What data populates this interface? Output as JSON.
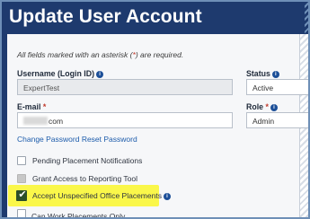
{
  "header": {
    "title": "Update User Account"
  },
  "note": {
    "prefix": "All fields marked with an asterisk (",
    "asterisk": "*",
    "suffix": ") are required."
  },
  "username": {
    "label": "Username (Login ID)",
    "value": "ExpertTest"
  },
  "status": {
    "label": "Status",
    "value": "Active"
  },
  "email": {
    "label": "E-mail",
    "required_mark": "*",
    "value_suffix": "com"
  },
  "role": {
    "label": "Role",
    "required_mark": "*",
    "value": "Admin"
  },
  "change_password_link": "Change Password Reset Password",
  "checkboxes": [
    {
      "label": "Pending Placement Notifications",
      "state": "unchecked"
    },
    {
      "label": "Grant Access to Reporting Tool",
      "state": "disabled"
    },
    {
      "label": "Accept Unspecified Office Placements",
      "state": "checked"
    }
  ],
  "cutoff_row": {
    "label": "Can Work Placements Only"
  },
  "colors": {
    "header_bg": "#1e3a6e",
    "link": "#1d5cab",
    "highlight": "#faf74a",
    "checkbox_checked": "#2b4e2a",
    "required": "#c0392b"
  },
  "icons": [
    "info-icon",
    "check-icon"
  ]
}
